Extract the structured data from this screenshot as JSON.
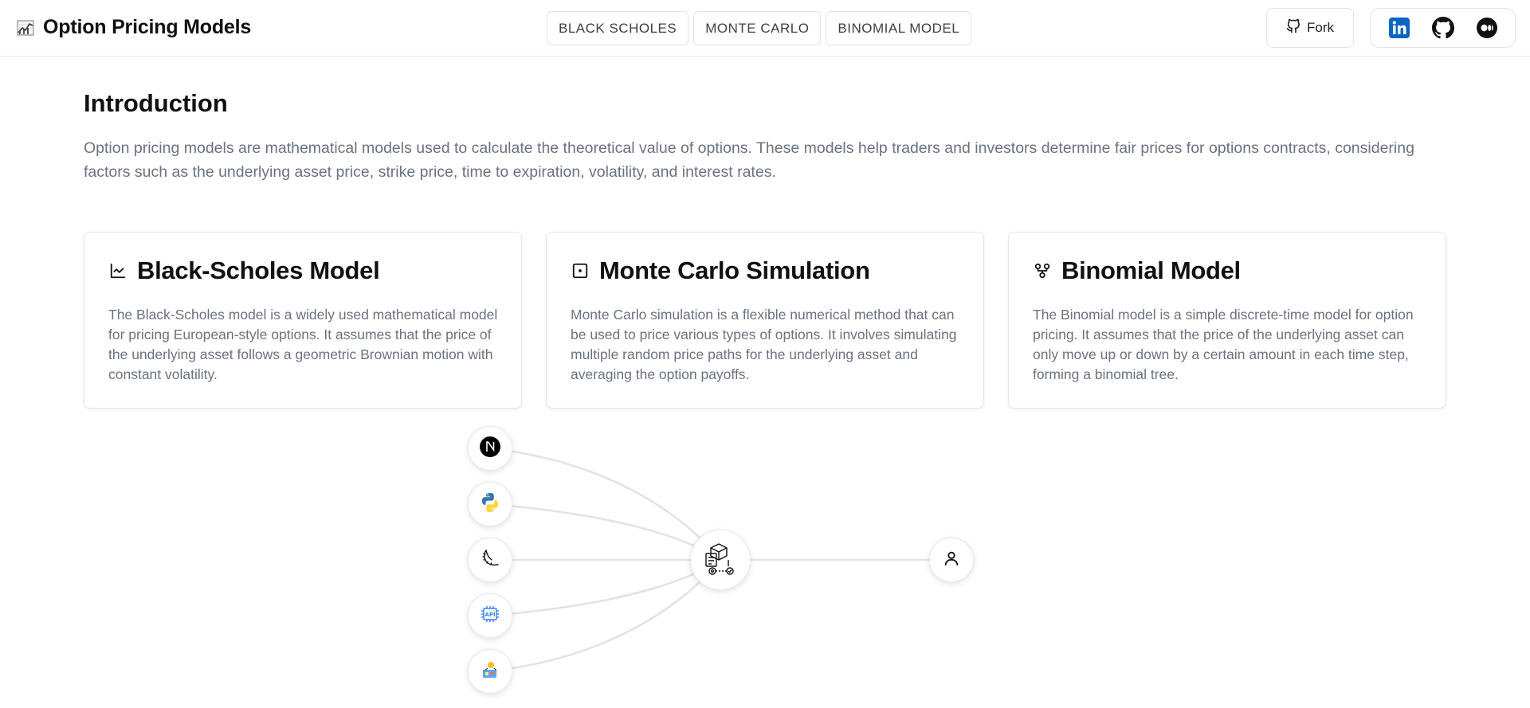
{
  "header": {
    "title": "Option Pricing Models",
    "nav": [
      "BLACK SCHOLES",
      "MONTE CARLO",
      "BINOMIAL MODEL"
    ],
    "fork_label": "Fork"
  },
  "intro": {
    "title": "Introduction",
    "text": "Option pricing models are mathematical models used to calculate the theoretical value of options. These models help traders and investors determine fair prices for options contracts, considering factors such as the underlying asset price, strike price, time to expiration, volatility, and interest rates."
  },
  "cards": [
    {
      "title": "Black-Scholes Model",
      "icon": "line-chart-icon",
      "text": "The Black-Scholes model is a widely used mathematical model for pricing European-style options. It assumes that the price of the underlying asset follows a geometric Brownian motion with constant volatility."
    },
    {
      "title": "Monte Carlo Simulation",
      "icon": "dice-icon",
      "text": "Monte Carlo simulation is a flexible numerical method that can be used to price various types of options. It involves simulating multiple random price paths for the underlying asset and averaging the option payoffs."
    },
    {
      "title": "Binomial Model",
      "icon": "git-fork-icon",
      "text": "The Binomial model is a simple discrete-time model for option pricing. It assumes that the price of the underlying asset can only move up or down by a certain amount in each time step, forming a binomial tree."
    }
  ],
  "diagram": {
    "sources": [
      "nextjs-icon",
      "python-icon",
      "flask-icon",
      "api-icon",
      "data-icon"
    ],
    "hub": "pipeline-icon",
    "target": "user-icon"
  },
  "colors": {
    "text_primary": "#111111",
    "text_muted": "#6b7280",
    "border": "#e5e5e8",
    "linkedin": "#0a66c2"
  }
}
